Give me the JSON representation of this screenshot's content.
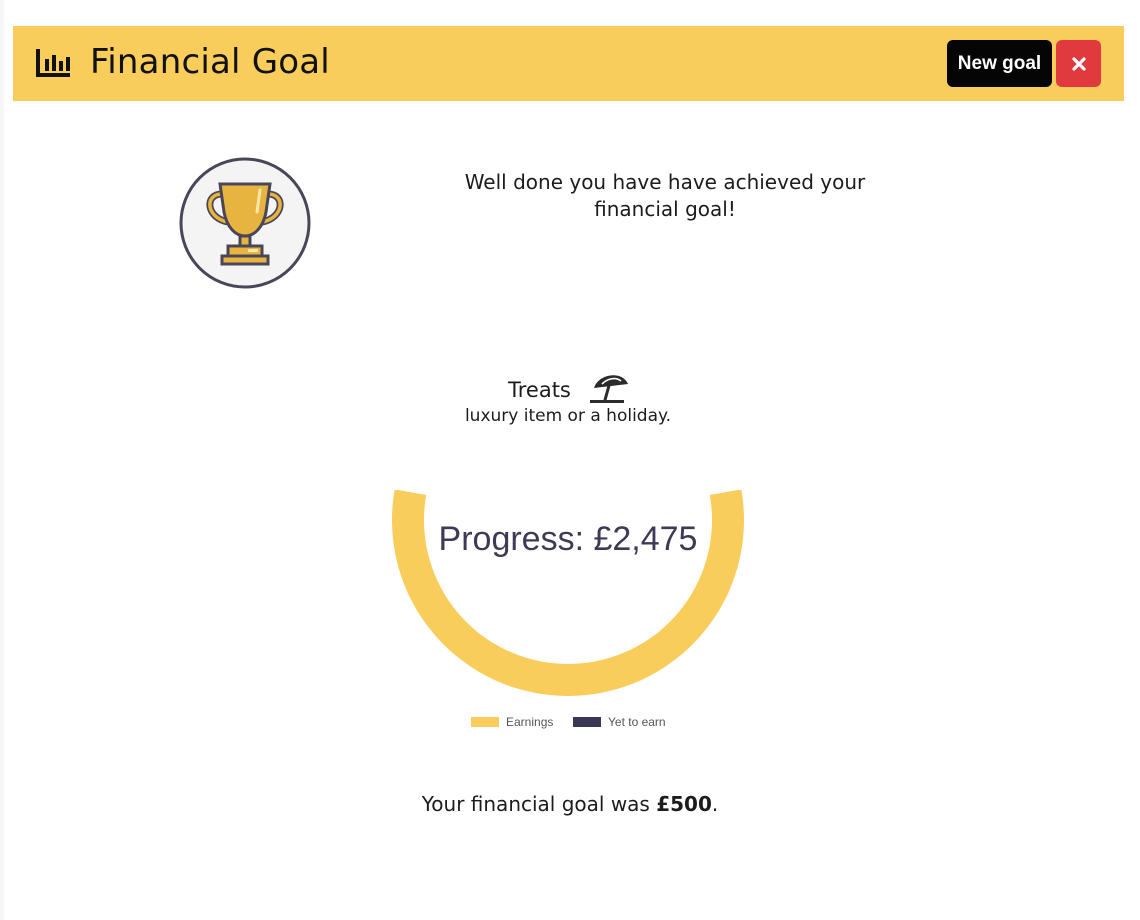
{
  "header": {
    "title": "Financial Goal",
    "title_icon": "bar-chart-icon",
    "new_goal_label": "New goal",
    "close_icon": "close-icon",
    "bg_color": "#f8cd5b"
  },
  "achievement": {
    "icon": "trophy-icon",
    "message": "Well done you have have achieved your financial goal!"
  },
  "goal": {
    "name": "Treats",
    "icon": "beach-umbrella-icon",
    "description": "luxury item or a holiday.",
    "final_prefix": "Your financial goal was ",
    "final_amount": "£500",
    "final_suffix": "."
  },
  "chart_data": {
    "type": "pie",
    "title": "Progress: £2,475",
    "series": [
      {
        "name": "Earnings",
        "value": 2475,
        "color": "#f8cd5b"
      },
      {
        "name": "Yet to earn",
        "value": 0,
        "color": "#3a3756"
      }
    ],
    "legend": "bottom"
  }
}
